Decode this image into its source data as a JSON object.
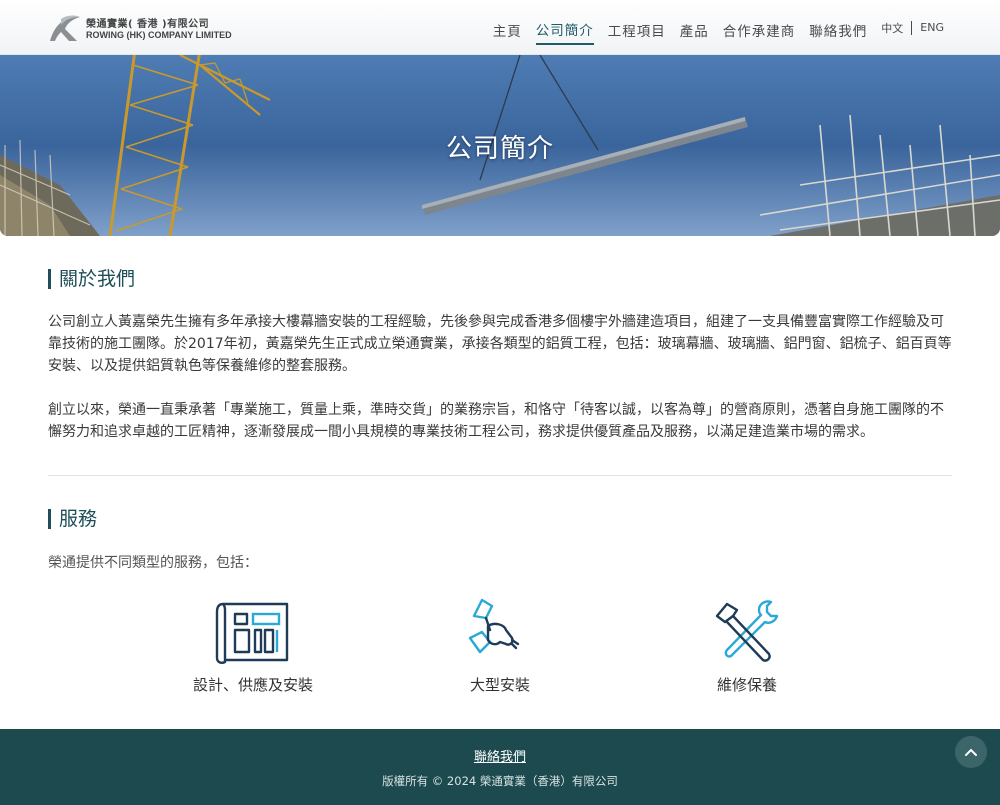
{
  "brand": {
    "name_cn": "榮通實業( 香港 )有限公司",
    "name_en": "ROWING (HK) COMPANY LIMITED"
  },
  "nav": {
    "items": [
      {
        "label": "主頁"
      },
      {
        "label": "公司簡介",
        "active": true
      },
      {
        "label": "工程項目"
      },
      {
        "label": "產品"
      },
      {
        "label": "合作承建商"
      },
      {
        "label": "聯絡我們"
      }
    ],
    "lang_cn": "中文",
    "lang_en": "ENG"
  },
  "hero": {
    "title": "公司簡介"
  },
  "about": {
    "heading": "關於我們",
    "para1": "公司創立人黃嘉榮先生擁有多年承接大樓幕牆安裝的工程經驗，先後參與完成香港多個樓宇外牆建造項目，組建了一支具備豐富實際工作經驗及可靠技術的施工團隊。於2017年初，黃嘉榮先生正式成立榮通實業，承接各類型的鋁質工程，包括：玻璃幕牆、玻璃牆、鋁門窗、鋁梳子、鋁百頁等安裝、以及提供鋁質執色等保養維修的整套服務。",
    "para2": "創立以來，榮通一直秉承著「專業施工，質量上乘，準時交貨」的業務宗旨，和恪守「待客以誠，以客為尊」的營商原則，憑著自身施工團隊的不懈努力和追求卓越的工匠精神，逐漸發展成一間小具規模的專業技術工程公司，務求提供優質產品及服務，以滿足建造業市場的需求。"
  },
  "services": {
    "heading": "服務",
    "intro": "榮通提供不同類型的服務，包括：",
    "items": [
      {
        "label": "設計、供應及安裝",
        "icon": "blueprint-icon"
      },
      {
        "label": "大型安裝",
        "icon": "hammer-install-icon"
      },
      {
        "label": "維修保養",
        "icon": "tools-repair-icon"
      }
    ]
  },
  "footer": {
    "contact_link": "聯絡我們",
    "copyright": "版權所有 © 2024 榮通實業（香港）有限公司"
  },
  "colors": {
    "brand_dark": "#1e4e58",
    "footer_bg": "#1d4a4e",
    "icon_navy": "#1f3b57",
    "icon_cyan": "#2aa9d8"
  }
}
